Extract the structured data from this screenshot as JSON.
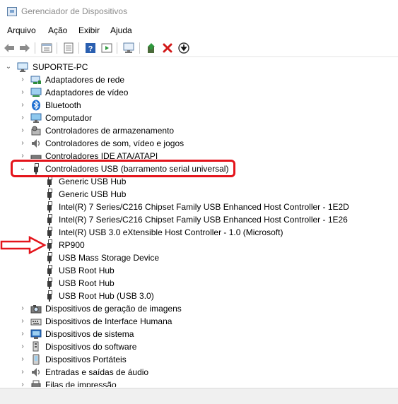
{
  "window": {
    "title": "Gerenciador de Dispositivos"
  },
  "menu": [
    "Arquivo",
    "Ação",
    "Exibir",
    "Ajuda"
  ],
  "toolbar": [
    "back-icon",
    "forward-icon",
    "properties-grid-icon",
    "show-hide-icon",
    "help-icon",
    "action-pane-icon",
    "scan-hardware-icon",
    "update-driver-icon",
    "uninstall-icon",
    "download-icon"
  ],
  "tree": {
    "root": "SUPORTE-PC",
    "categories_before": [
      {
        "label": "Adaptadores de rede",
        "icon": "network-adapter-icon"
      },
      {
        "label": "Adaptadores de vídeo",
        "icon": "display-adapter-icon"
      },
      {
        "label": "Bluetooth",
        "icon": "bluetooth-icon"
      },
      {
        "label": "Computador",
        "icon": "computer-icon"
      },
      {
        "label": "Controladores de armazenamento",
        "icon": "storage-controller-icon"
      },
      {
        "label": "Controladores de som, vídeo e jogos",
        "icon": "sound-icon"
      },
      {
        "label": "Controladores IDE ATA/ATAPI",
        "icon": "ide-icon"
      }
    ],
    "usb_category": "Controladores USB (barramento serial universal)",
    "usb_devices": [
      "Generic USB Hub",
      "Generic USB Hub",
      "Intel(R) 7 Series/C216 Chipset Family USB Enhanced Host Controller - 1E2D",
      "Intel(R) 7 Series/C216 Chipset Family USB Enhanced Host Controller - 1E26",
      "Intel(R) USB 3.0 eXtensible Host Controller - 1.0 (Microsoft)",
      "RP900",
      "USB Mass Storage Device",
      "USB Root Hub",
      "USB Root Hub",
      "USB Root Hub (USB 3.0)"
    ],
    "categories_after": [
      {
        "label": "Dispositivos de geração de imagens",
        "icon": "imaging-icon"
      },
      {
        "label": "Dispositivos de Interface Humana",
        "icon": "hid-icon"
      },
      {
        "label": "Dispositivos de sistema",
        "icon": "system-devices-icon"
      },
      {
        "label": "Dispositivos do software",
        "icon": "software-devices-icon"
      },
      {
        "label": "Dispositivos Portáteis",
        "icon": "portable-devices-icon"
      },
      {
        "label": "Entradas e saídas de áudio",
        "icon": "audio-io-icon"
      },
      {
        "label": "Filas de impressão",
        "icon": "print-queue-icon"
      }
    ]
  },
  "annotation_color": "#e4141b"
}
